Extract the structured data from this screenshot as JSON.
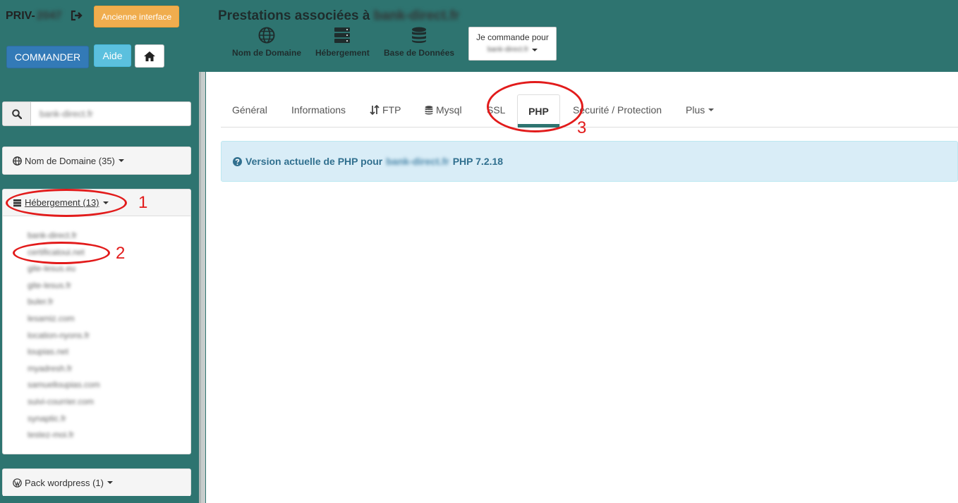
{
  "header": {
    "priv_label": "PRIV-",
    "priv_id": "2047",
    "logout_icon": "sign-out-icon",
    "old_interface_label": "Ancienne interface",
    "commander_label": "COMMANDER",
    "aide_label": "Aide",
    "home_icon": "home-icon",
    "title_prefix": "Prestations associées à",
    "title_domain": "bank-direct.fr",
    "services": [
      {
        "label": "Nom de Domaine",
        "icon": "globe-icon"
      },
      {
        "label": "Hébergement",
        "icon": "server-icon"
      },
      {
        "label": "Base de Données",
        "icon": "database-icon"
      }
    ],
    "order_for": {
      "label": "Je commande pour",
      "value": "bank-direct.fr"
    }
  },
  "sidebar": {
    "search": {
      "value": "bank-direct.fr",
      "icon": "search-icon"
    },
    "domain_panel": {
      "label": "Nom de Domaine (35)",
      "icon": "globe-icon"
    },
    "hosting_panel": {
      "label": "Hébergement (13)",
      "icon": "server-icon",
      "items": [
        "bank-direct.fr",
        "certificatoui.net",
        "gite-lesus.eu",
        "gite-lesus.fr",
        "buler.fr",
        "lesamiz.com",
        "location-nyons.fr",
        "loupias.net",
        "myadresh.fr",
        "samuelloupias.com",
        "suivi-courrier.com",
        "synaptic.fr",
        "testez-moi.fr"
      ]
    },
    "wp_panel": {
      "label": "Pack wordpress (1)",
      "icon": "wordpress-icon"
    }
  },
  "tabs": [
    {
      "label": "Général"
    },
    {
      "label": "Informations"
    },
    {
      "label": "FTP",
      "icon": "sort-arrows-icon"
    },
    {
      "label": "Mysql",
      "icon": "database-icon"
    },
    {
      "label": "SSL"
    },
    {
      "label": "PHP",
      "active": true
    },
    {
      "label": "Securité / Protection"
    },
    {
      "label": "Plus"
    }
  ],
  "alert": {
    "prefix": "Version actuelle de PHP pour",
    "domain": "bank-direct.fr",
    "version": "PHP 7.2.18",
    "icon": "question-circle-icon"
  },
  "annotations": [
    "1",
    "2",
    "3"
  ],
  "colors": {
    "teal": "#2e7470",
    "orange": "#f0ad4e",
    "blue": "#337ab7",
    "cyan": "#5bc0de",
    "annotation_red": "#e21b1b",
    "alert_bg": "#d9edf7"
  }
}
